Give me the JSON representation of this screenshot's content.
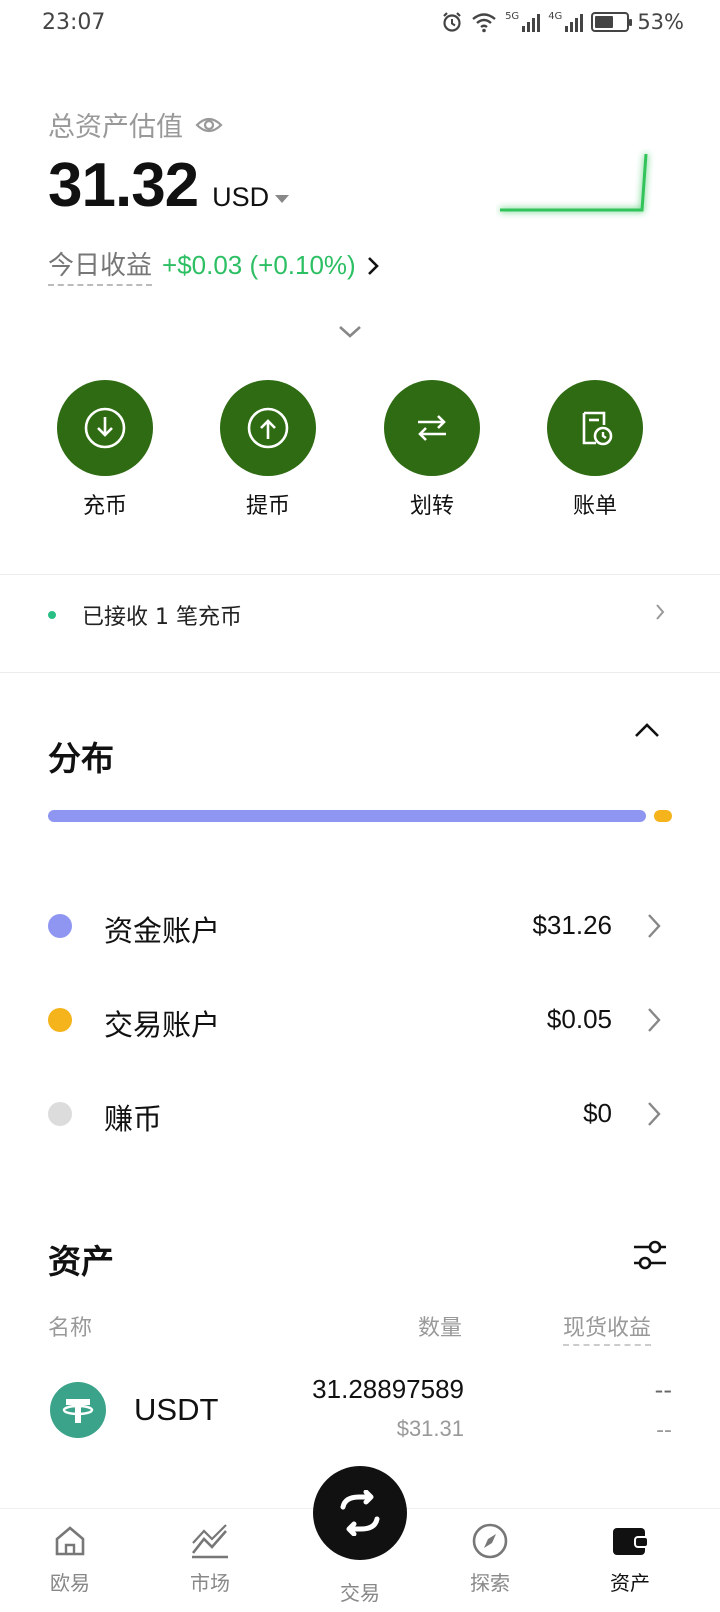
{
  "status_bar": {
    "time": "23:07",
    "battery": "53%",
    "battery_level": 0.53,
    "net1": "5G",
    "net2": "4G"
  },
  "header": {
    "total_label": "总资产估值",
    "total_value": "31.32",
    "currency": "USD",
    "pnl_label": "今日收益",
    "pnl_value": "+$0.03 (+0.10%)"
  },
  "actions": [
    {
      "label": "充币",
      "icon": "deposit-icon"
    },
    {
      "label": "提币",
      "icon": "withdraw-icon"
    },
    {
      "label": "划转",
      "icon": "transfer-icon"
    },
    {
      "label": "账单",
      "icon": "bill-icon"
    }
  ],
  "notice": {
    "text": "已接收 1 笔充币"
  },
  "distribution": {
    "title": "分布",
    "items": [
      {
        "name": "资金账户",
        "value": "$31.26",
        "color": "#8f96f2",
        "share": 0.998
      },
      {
        "name": "交易账户",
        "value": "$0.05",
        "color": "#f5b31c",
        "share": 0.002
      },
      {
        "name": "赚币",
        "value": "$0",
        "color": "#dcdcdc",
        "share": 0
      }
    ]
  },
  "assets": {
    "title": "资产",
    "col_name": "名称",
    "col_qty": "数量",
    "col_pnl": "现货收益",
    "rows": [
      {
        "symbol": "USDT",
        "qty": "31.28897589",
        "usd": "$31.31",
        "pnl": "--",
        "pnl2": "--"
      }
    ]
  },
  "nav": {
    "items": [
      {
        "label": "欧易",
        "icon": "home-icon"
      },
      {
        "label": "市场",
        "icon": "market-chart-icon"
      },
      {
        "label": "交易",
        "icon": "swap-icon"
      },
      {
        "label": "探索",
        "icon": "compass-icon"
      },
      {
        "label": "资产",
        "icon": "wallet-icon"
      }
    ],
    "active": "资产"
  },
  "colors": {
    "accent_green": "#2e6b12",
    "pnl_green": "#2dbf63"
  }
}
